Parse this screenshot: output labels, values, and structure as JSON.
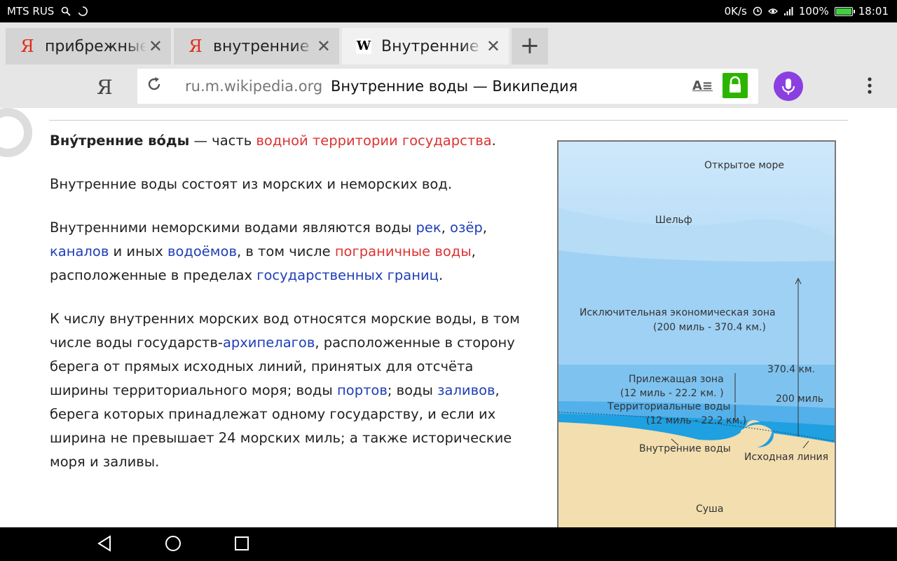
{
  "status_bar": {
    "carrier": "MTS RUS",
    "speed": "0K/s",
    "battery": "100%",
    "battery_level": 1.0,
    "time": "18:01"
  },
  "tabs": [
    {
      "label": "прибрежные",
      "favicon": "yandex-icon",
      "active": false
    },
    {
      "label": "внутренние",
      "favicon": "yandex-icon",
      "active": false
    },
    {
      "label": "Внутренние",
      "favicon": "wikipedia-icon",
      "active": true
    }
  ],
  "tab_glyphs": {
    "yandex": "Я",
    "wiki": "W",
    "close": "✕",
    "new_tab": "+"
  },
  "address_bar": {
    "home_glyph": "Я",
    "domain": "ru.m.wikipedia.org",
    "page_title": "Внутренние воды — Википедия",
    "reader_glyph": "A≡",
    "lock_color": "#2cb500",
    "mic_color": "#8b3fe0",
    "menu_glyph": "⋮"
  },
  "article": {
    "p1": {
      "term": "Вну́тренние во́ды",
      "t1": " — часть ",
      "link1": "водной территории государства",
      "t2": "."
    },
    "p2": "Внутренние воды состоят из морских и неморских вод.",
    "p3": {
      "t1": "Внутренними неморскими водами являются воды ",
      "l1": "рек",
      "t2": ", ",
      "l2": "озёр",
      "t3": ",",
      "l3": "каналов",
      "t4": " и иных ",
      "l4": "водоёмов",
      "t5": ", в том числе ",
      "l5": "пограничные воды",
      "t6": ",",
      "t7": "расположенные в пределах ",
      "l6": "государственных границ",
      "t8": "."
    },
    "p4": {
      "t1": "К числу внутренних морских вод относятся морские воды, в том числе воды государств-",
      "l1": "архипелагов",
      "t2": ", расположенные в сторону берега от прямых исходных линий, принятых для отсчёта ширины территориального моря; воды ",
      "l2": "портов",
      "t3": "; воды ",
      "l3": "заливов",
      "t4": ", берега которых принадлежат одному государству, и если их ширина не превышает 24 морских миль; а также исторические моря и заливы."
    }
  },
  "figure": {
    "open_sea": "Открытое море",
    "shelf": "Шельф",
    "eez": "Исключительная экономическая зона",
    "eez_range": "(200 миль - 370.4 км.)",
    "dist_km": "370.4  км.",
    "dist_miles": "200  миль",
    "contig": "Прилежащая зона",
    "contig_range": "(12 миль - 22.2 км. )",
    "territorial": "Территориальные воды",
    "territorial_range": "(12 миль - 22.2 км.)",
    "internal": "Внутренние воды",
    "baseline": "Исходная линия",
    "land": "Суша"
  },
  "nav_bar": {
    "back": "back-icon",
    "home": "home-icon",
    "recents": "recents-icon"
  }
}
